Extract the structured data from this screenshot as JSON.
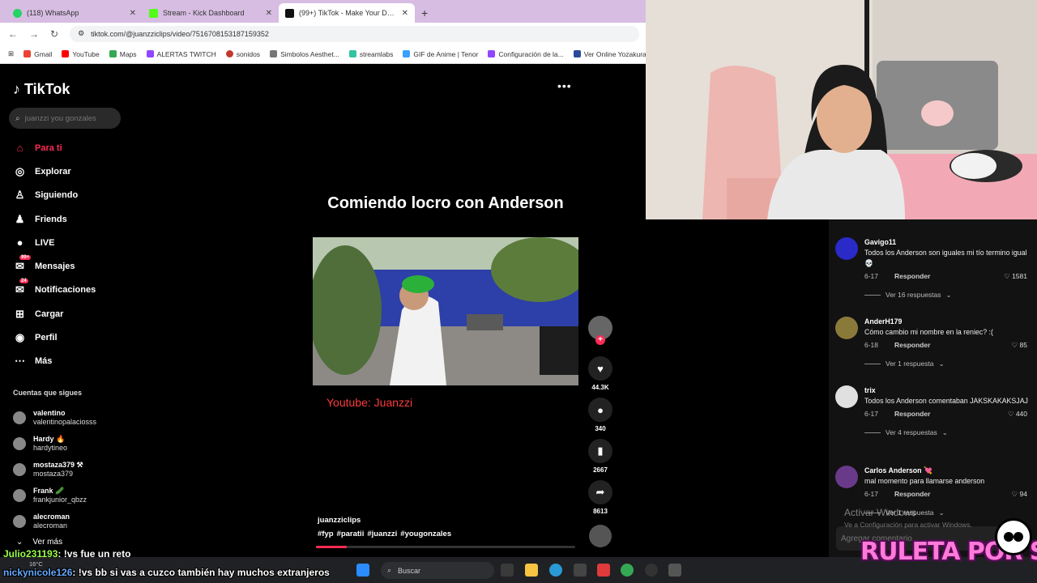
{
  "browser": {
    "tabs": [
      {
        "title": "(118) WhatsApp",
        "color": "#25d366",
        "active": false
      },
      {
        "title": "Stream - Kick Dashboard",
        "color": "#53fc18",
        "active": false
      },
      {
        "title": "(99+) TikTok - Make Your Da...",
        "color": "#111111",
        "active": true
      }
    ],
    "url": "tiktok.com/@juanzziclips/video/7516708153187159352",
    "bookmarks": [
      "Gmail",
      "YouTube",
      "Maps",
      "ALERTAS TWITCH",
      "sonidos",
      "Simbolos Aesthet...",
      "streamlabs",
      "GIF de Anime | Tenor",
      "Configuración de la...",
      "Ver Online Yozakura..."
    ]
  },
  "tiktok": {
    "logo": "TikTok",
    "search_placeholder": "juanzzi you gonzales",
    "nav": [
      {
        "label": "Para ti",
        "icon": "home-icon",
        "glyph": "⌂",
        "active": true
      },
      {
        "label": "Explorar",
        "icon": "compass-icon",
        "glyph": "◎"
      },
      {
        "label": "Siguiendo",
        "icon": "following-icon",
        "glyph": "♙"
      },
      {
        "label": "Friends",
        "icon": "friends-icon",
        "glyph": "♟"
      },
      {
        "label": "LIVE",
        "icon": "live-icon",
        "glyph": "●"
      },
      {
        "label": "Mensajes",
        "icon": "messages-icon",
        "glyph": "✉",
        "badge": "99+"
      },
      {
        "label": "Notificaciones",
        "icon": "notifications-icon",
        "glyph": "✉",
        "badge": "24"
      },
      {
        "label": "Cargar",
        "icon": "upload-icon",
        "glyph": "⊞"
      },
      {
        "label": "Perfil",
        "icon": "profile-icon",
        "glyph": "◉"
      },
      {
        "label": "Más",
        "icon": "more-icon",
        "glyph": "⋯"
      }
    ],
    "following_title": "Cuentas que sigues",
    "accounts": [
      {
        "name": "valentino",
        "handle": "valentinopalaciosss"
      },
      {
        "name": "Hardy 🔥",
        "handle": "hardytineo"
      },
      {
        "name": "mostaza379 ⚒",
        "handle": "mostaza379"
      },
      {
        "name": "Frank 🥒",
        "handle": "frankjunior_qbzz"
      },
      {
        "name": "alecroman",
        "handle": "alecroman"
      }
    ],
    "see_more": "Ver más",
    "video": {
      "title": "Comiendo locro con Anderson",
      "overlay_text": "Youtube: Juanzzi",
      "author": "juanzziclips",
      "hashtags": [
        "#fyp",
        "#paratii",
        "#juanzzi",
        "#yougonzales"
      ],
      "progress": 0.12
    },
    "actions": [
      {
        "icon": "heart-icon",
        "glyph": "♥",
        "count": "44.3K"
      },
      {
        "icon": "comment-icon",
        "glyph": "●",
        "count": "340"
      },
      {
        "icon": "bookmark-icon",
        "glyph": "▮",
        "count": "2667"
      },
      {
        "icon": "share-icon",
        "glyph": "➦",
        "count": "8613"
      }
    ]
  },
  "comments": [
    {
      "user": "Gavigo11",
      "text": "Todos los Anderson son iguales mi tío termino igual 💀",
      "date": "6-17",
      "reply": "Responder",
      "likes": "1581",
      "more": "Ver 16 respuestas",
      "avatar": "#2a2ac8"
    },
    {
      "user": "AnderH179",
      "text": "Cómo cambio mi nombre en la reniec? :(",
      "date": "6-18",
      "reply": "Responder",
      "likes": "85",
      "more": "Ver 1 respuesta",
      "avatar": "#8a7a3a"
    },
    {
      "user": "trix",
      "text": "Todos los Anderson comentaban JAKSKAKAKSJAJ",
      "date": "6-17",
      "reply": "Responder",
      "likes": "440",
      "more": "Ver 4 respuestas",
      "avatar": "#e0e0e0"
    },
    {
      "user": "Carlos Anderson 💘",
      "text": "mal momento para llamarse anderson",
      "date": "6-17",
      "reply": "Responder",
      "likes": "94",
      "more": "Ver 1 respuesta",
      "avatar": "#6a3a8a"
    }
  ],
  "add_comment_placeholder": "Agregar comentario...",
  "windows_notice": {
    "title": "Activar Windows",
    "subtitle": "Ve a Configuración para activar Windows."
  },
  "chat": [
    {
      "user": "Julio231193",
      "message": ": !vs fue un reto"
    },
    {
      "user": "nickynicole126",
      "message": ": !vs bb si vas a cuzco también hay muchos extranjeros"
    }
  ],
  "taskbar": {
    "search": "Buscar",
    "weather": "16°C"
  },
  "overlay_brand": "RULETA POR SUB"
}
